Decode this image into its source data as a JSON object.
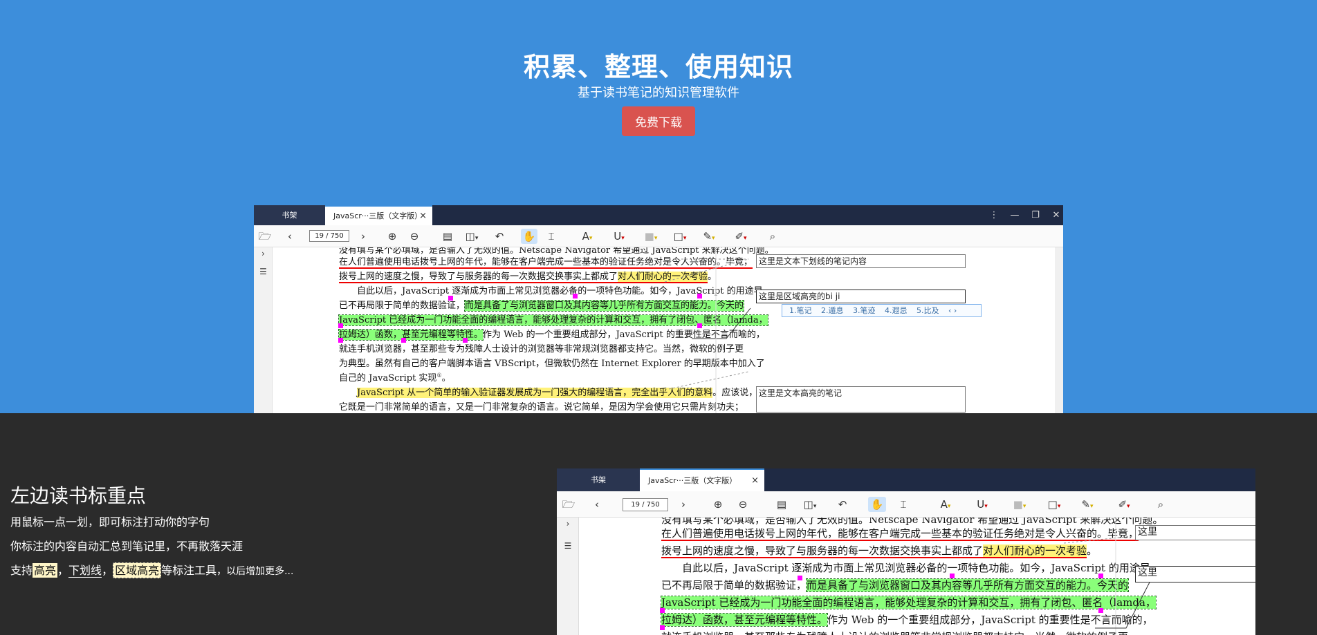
{
  "hero": {
    "title": "积累、整理、使用知识",
    "subtitle": "基于读书笔记的知识管理软件",
    "download_label": "免费下载"
  },
  "app": {
    "tabs": {
      "shelf": "书架",
      "doc": "JavaScr···三版（文字版）"
    },
    "page_indicator": "19 / 750",
    "window_controls": {
      "more": "⋮",
      "minimize": "—",
      "restore": "❐",
      "close": "✕"
    },
    "toolbar_icons": [
      "open-folder-icon",
      "prev-page-icon",
      "next-page-icon",
      "zoom-in-icon",
      "zoom-out-icon",
      "page-view-icon",
      "layout-icon",
      "undo-icon",
      "hand-tool-icon",
      "select-tool-icon",
      "text-highlight-icon",
      "underline-icon",
      "area-highlight-icon",
      "rectangle-icon",
      "marker-icon",
      "pen-icon",
      "search-icon"
    ],
    "doc_lines": [
      "没有填写某个必填域，是否输入了无效的值。Netscape Navigator 希望通过 JavaScript 来解决这个问题。",
      "在人们普遍使用电话拨号上网的年代，能够在客户端完成一些基本的验证任务绝对是令人兴奋的。毕竟，",
      "拨号上网的速度之慢，导致了与服务器的每一次数据交换事实上都成了",
      "对人们耐心的一次考验",
      "。",
      "自此以后，JavaScript 逐渐成为市面上常见浏览器必备的一项特色功能。如今，JavaScript 的用途早",
      "已不再局限于简单的数据验证，",
      "而是具备了与浏览器窗口及其内容等几乎所有方面交互的能力。今天的",
      "JavaScript 已经成为一门功能全面的编程语言，能够处理复杂的计算和交互，拥有了闭包、匿名（lamda，",
      "拉姆达）函数，甚至元编程等特性。",
      "作为 Web 的一个重要组成部分，JavaScript 的重要性是不言而喻的，",
      "就连手机浏览器，甚至那些专为残障人士设计的浏览器等非常规浏览器都支持它。当然，微软的例子更",
      "为典型。虽然有自己的客户端脚本语言 VBScript，但微软仍然在 Internet Explorer 的早期版本中加入了",
      "自己的 JavaScript 实现",
      "①",
      "。",
      "JavaScript 从一个简单的输入验证器发展成为一门强大的编程语言，完全出乎人们的意料",
      "。应该说，",
      "它既是一门非常简单的语言，又是一门非常复杂的语言。说它简单，是因为学会使用它只需片刻功夫；"
    ],
    "notes": {
      "underline_note": "这里是文本下划线的笔记内容",
      "area_note": "这里是区域高亮的bi ji",
      "text_note": "这里是文本高亮的笔记",
      "short1": "这里",
      "short2": "这里"
    },
    "candidates": [
      "1.笔记",
      "2.遁息",
      "3.笔迹",
      "4.遐忌",
      "5.比及"
    ],
    "candidate_nav": "‹ ›"
  },
  "feature": {
    "title": "左边读书标重点",
    "line1": "用鼠标一点一划，即可标注打动你的字句",
    "line2": "你标注的内容自动汇总到笔记里，不再散落天涯",
    "support": "支持",
    "highlight": "高亮",
    "comma1": "，",
    "underline": "下划线",
    "comma2": "，",
    "area": "区域高亮",
    "tools": "等标注工具",
    "more": "，以后增加更多..."
  }
}
